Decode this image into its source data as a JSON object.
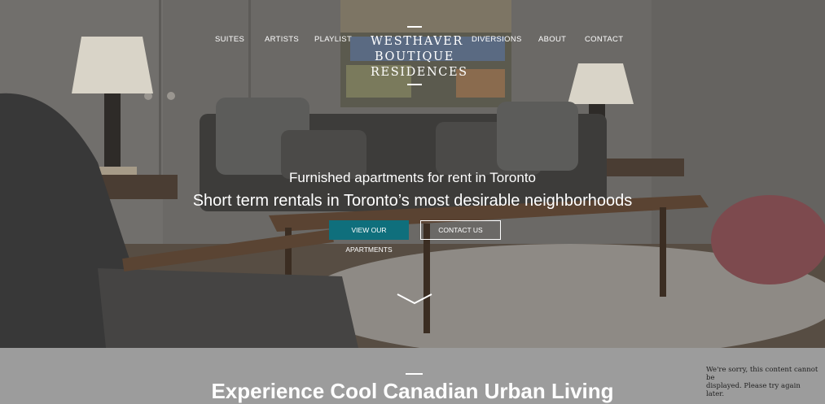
{
  "nav": {
    "left": [
      "SUITES",
      "ARTISTS",
      "PLAYLIST"
    ],
    "right": [
      "DIVERSIONS",
      "ABOUT",
      "CONTACT"
    ]
  },
  "logo": {
    "line1": "WESTHAVER",
    "line2": "BOUTIQUE",
    "line3": "RESIDENCES"
  },
  "hero": {
    "tagline_small": "Furnished apartments for rent in Toronto",
    "tagline_large": "Short term rentals in Toronto’s most desirable neighborhoods",
    "primary_button": "VIEW OUR APARTMENTS",
    "secondary_button": "CONTACT US",
    "accent_color": "#0f6f7c"
  },
  "section": {
    "title": "Experience Cool Canadian Urban Living"
  },
  "embed_error": {
    "line1": "We're sorry, this content cannot be",
    "line2": "displayed. Please try again later."
  },
  "icons": [
    "chevron-down-icon"
  ]
}
